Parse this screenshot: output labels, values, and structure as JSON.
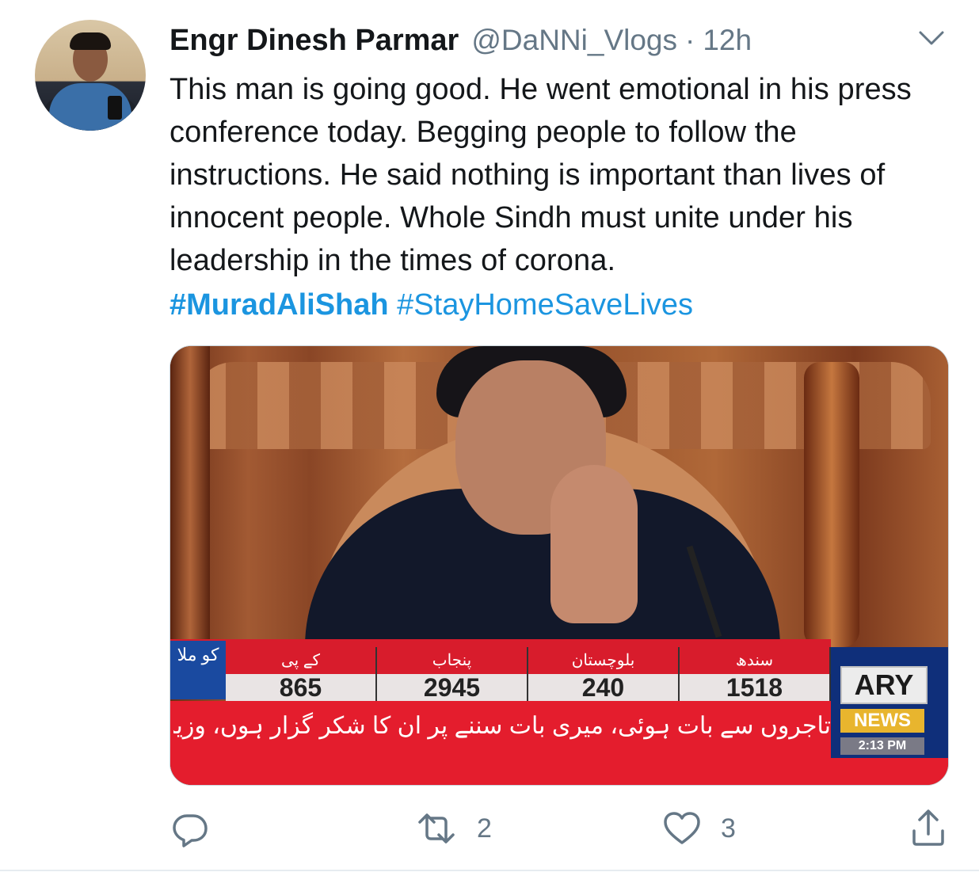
{
  "tweet": {
    "author_name": "Engr Dinesh Parmar",
    "handle": "@DaNNi_Vlogs",
    "separator": "·",
    "time": "12h",
    "body": "This man is going good. He went emotional in his press conference today. Begging people to follow the instructions. He said nothing is important than lives of innocent people. Whole Sindh must unite under his leadership in the times of corona.",
    "hashtags": [
      "#MuradAliShah",
      "#StayHomeSaveLives"
    ]
  },
  "media": {
    "ticker": [
      {
        "region": "کے پی",
        "count": "865"
      },
      {
        "region": "پنجاب",
        "count": "2945"
      },
      {
        "region": "بلوچستان",
        "count": "240"
      },
      {
        "region": "سندھ",
        "count": "1518"
      }
    ],
    "ticker_left": "کو\nملا",
    "urdu_headline": "تاجروں سے بات ہوئی، میری بات سننے پر ان کا شکر گزار ہوں، وزیر اعلیٰ",
    "channel_logo": "ARY",
    "channel_news": "NEWS",
    "channel_time": "2:13 PM"
  },
  "actions": {
    "reply_icon": "reply-icon",
    "retweet_count": "2",
    "like_count": "3",
    "share_icon": "share-icon"
  },
  "colors": {
    "link": "#1b95e0",
    "muted": "#657786",
    "text": "#14171a"
  }
}
